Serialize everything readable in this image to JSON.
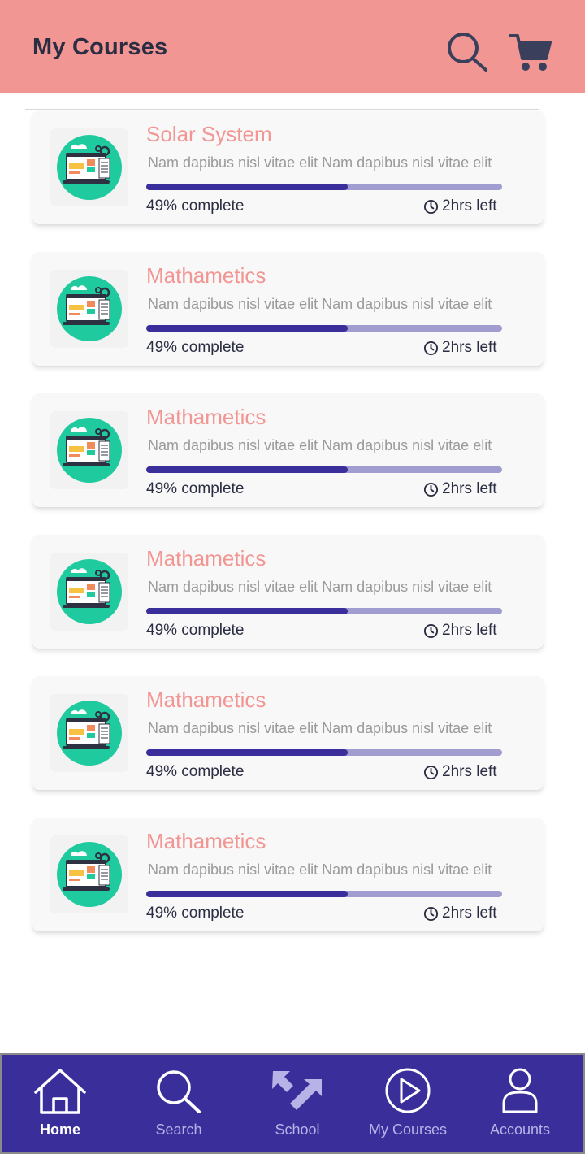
{
  "header": {
    "title": "My Courses",
    "search_icon": "search-icon",
    "cart_icon": "cart-icon",
    "background": "#f29694"
  },
  "courses": [
    {
      "title": "Solar System",
      "description": "Nam dapibus nisl vitae elit Nam dapibus nisl vitae elit",
      "progress_label": "49% complete",
      "progress": 0.567,
      "time_left": "2hrs left"
    },
    {
      "title": "Mathametics",
      "description": "Nam dapibus nisl vitae elit Nam dapibus nisl vitae elit",
      "progress_label": "49% complete",
      "progress": 0.567,
      "time_left": "2hrs left"
    },
    {
      "title": "Mathametics",
      "description": "Nam dapibus nisl vitae elit Nam dapibus nisl vitae elit",
      "progress_label": "49% complete",
      "progress": 0.567,
      "time_left": "2hrs left"
    },
    {
      "title": "Mathametics",
      "description": "Nam dapibus nisl vitae elit Nam dapibus nisl vitae elit",
      "progress_label": "49% complete",
      "progress": 0.567,
      "time_left": "2hrs left"
    },
    {
      "title": "Mathametics",
      "description": "Nam dapibus nisl vitae elit Nam dapibus nisl vitae elit",
      "progress_label": "49% complete",
      "progress": 0.567,
      "time_left": "2hrs left"
    },
    {
      "title": "Mathametics",
      "description": "Nam dapibus nisl vitae elit Nam dapibus nisl vitae elit",
      "progress_label": "49% complete",
      "progress": 0.567,
      "time_left": "2hrs left"
    }
  ],
  "bottom_nav": {
    "items": [
      {
        "label": "Home",
        "icon": "home-icon",
        "active": true
      },
      {
        "label": "Search",
        "icon": "search-icon",
        "active": false
      },
      {
        "label": "School",
        "icon": "school-icon",
        "active": false
      },
      {
        "label": "My Courses",
        "icon": "play-icon",
        "active": false
      },
      {
        "label": "Accounts",
        "icon": "user-icon",
        "active": false
      }
    ],
    "background": "#3a2f9a"
  },
  "colors": {
    "accent": "#f29694",
    "progress_fill": "#3a2f9a",
    "progress_track": "#a19dd1",
    "text_dark": "#2b2d42",
    "text_muted": "#9a9a9a"
  }
}
